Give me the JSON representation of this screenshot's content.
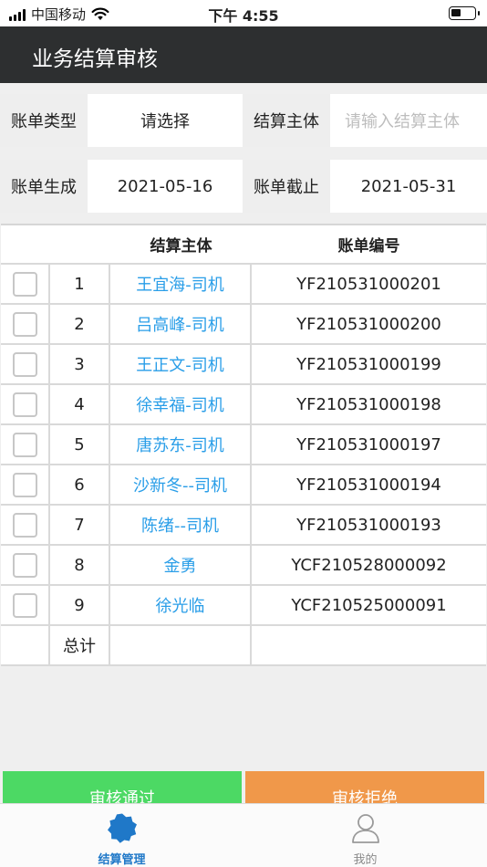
{
  "status_bar": {
    "carrier": "中国移动",
    "time": "下午 4:55",
    "battery_level": 0.45
  },
  "nav": {
    "title": "业务结算审核"
  },
  "filters": {
    "bill_type_label": "账单类型",
    "bill_type_value": "请选择",
    "settle_entity_label": "结算主体",
    "settle_entity_placeholder": "请输入结算主体",
    "bill_generate_label": "账单生成",
    "bill_generate_value": "2021-05-16",
    "bill_end_label": "账单截止",
    "bill_end_value": "2021-05-31"
  },
  "table": {
    "headers": {
      "entity": "结算主体",
      "bill_no": "账单编号"
    },
    "rows": [
      {
        "index": "1",
        "entity": "王宜海-司机",
        "bill_no": "YF210531000201"
      },
      {
        "index": "2",
        "entity": "吕高峰-司机",
        "bill_no": "YF210531000200"
      },
      {
        "index": "3",
        "entity": "王正文-司机",
        "bill_no": "YF210531000199"
      },
      {
        "index": "4",
        "entity": "徐幸福-司机",
        "bill_no": "YF210531000198"
      },
      {
        "index": "5",
        "entity": "唐苏东-司机",
        "bill_no": "YF210531000197"
      },
      {
        "index": "6",
        "entity": "沙新冬--司机",
        "bill_no": "YF210531000194"
      },
      {
        "index": "7",
        "entity": "陈绪--司机",
        "bill_no": "YF210531000193"
      },
      {
        "index": "8",
        "entity": "金勇",
        "bill_no": "YCF210528000092"
      },
      {
        "index": "9",
        "entity": "徐光临",
        "bill_no": "YCF210525000091"
      }
    ],
    "total_label": "总计"
  },
  "actions": {
    "approve_label": "审核通过",
    "reject_label": "审核拒绝"
  },
  "tabbar": {
    "settlement_label": "结算管理",
    "mine_label": "我的"
  },
  "colors": {
    "nav_bg": "#2d2f30",
    "link_blue": "#2a9ee8",
    "approve_green": "#4cd964",
    "reject_orange": "#f0984a",
    "tab_active": "#1f78c8"
  },
  "icons": {
    "wifi": "wifi-icon",
    "battery": "battery-icon",
    "settlement": "settlement-badge-icon",
    "mine": "user-icon"
  }
}
